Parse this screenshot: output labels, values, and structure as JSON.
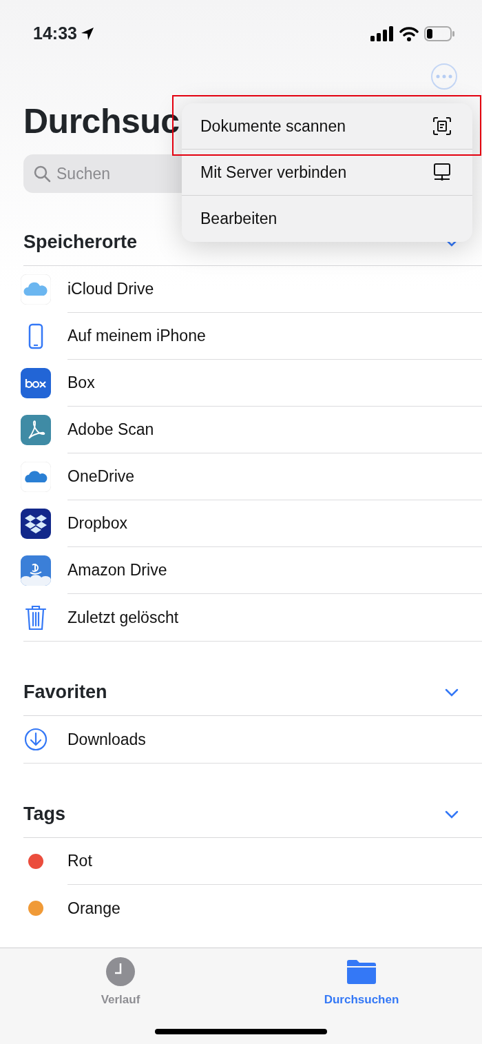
{
  "status_bar": {
    "time": "14:33"
  },
  "title": "Durchsuc",
  "search": {
    "placeholder": "Suchen"
  },
  "menu": {
    "items": [
      {
        "label": "Dokumente scannen",
        "kind": "scan",
        "highlighted": true
      },
      {
        "label": "Mit Server verbinden",
        "kind": "server",
        "highlighted": false
      },
      {
        "label": "Bearbeiten",
        "kind": "plain",
        "highlighted": false
      }
    ]
  },
  "sections": [
    {
      "title": "Speicherorte",
      "expanded": true,
      "items": [
        {
          "label": "iCloud Drive",
          "kind": "icloud"
        },
        {
          "label": "Auf meinem iPhone",
          "kind": "phone"
        },
        {
          "label": "Box",
          "kind": "box"
        },
        {
          "label": "Adobe Scan",
          "kind": "adobe"
        },
        {
          "label": "OneDrive",
          "kind": "onedrive"
        },
        {
          "label": "Dropbox",
          "kind": "dropbox"
        },
        {
          "label": "Amazon Drive",
          "kind": "amazon"
        },
        {
          "label": "Zuletzt gelöscht",
          "kind": "trash"
        }
      ]
    },
    {
      "title": "Favoriten",
      "expanded": true,
      "items": [
        {
          "label": "Downloads",
          "kind": "download"
        }
      ]
    },
    {
      "title": "Tags",
      "expanded": true,
      "items": [
        {
          "label": "Rot",
          "kind": "tag",
          "color": "#eb4d3d"
        },
        {
          "label": "Orange",
          "kind": "tag",
          "color": "#f09a37"
        }
      ]
    }
  ],
  "tab_bar": [
    {
      "label": "Verlauf",
      "kind": "clock",
      "selected": false
    },
    {
      "label": "Durchsuchen",
      "kind": "folder",
      "selected": true
    }
  ]
}
